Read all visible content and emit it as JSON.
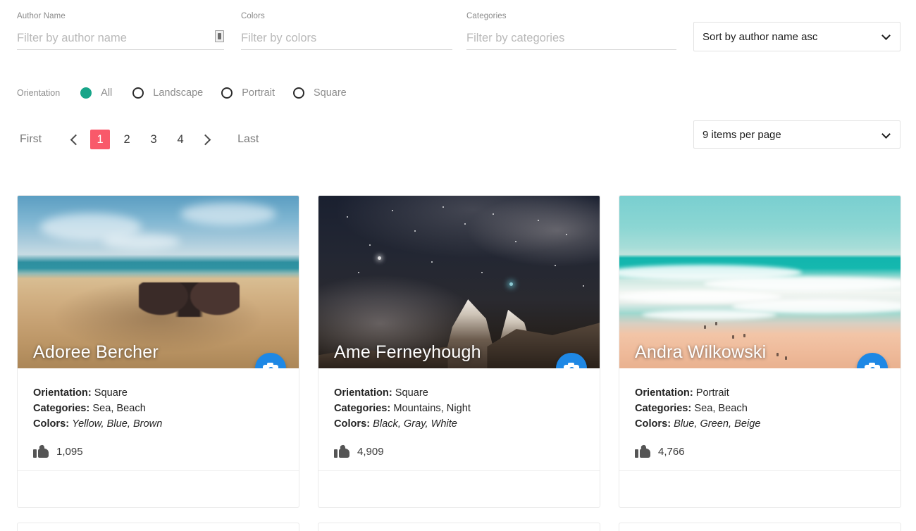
{
  "filters": {
    "author": {
      "label": "Author Name",
      "placeholder": "Filter by author name",
      "value": ""
    },
    "colors": {
      "label": "Colors",
      "placeholder": "Filter by colors",
      "value": ""
    },
    "categories": {
      "label": "Categories",
      "placeholder": "Filter by categories",
      "value": ""
    },
    "sort": {
      "selected": "Sort by author name asc"
    }
  },
  "orientation": {
    "label": "Orientation",
    "selected": "All",
    "options": [
      {
        "label": "All",
        "selected": true
      },
      {
        "label": "Landscape",
        "selected": false
      },
      {
        "label": "Portrait",
        "selected": false
      },
      {
        "label": "Square",
        "selected": false
      }
    ]
  },
  "pagination": {
    "first_label": "First",
    "last_label": "Last",
    "pages": [
      "1",
      "2",
      "3",
      "4"
    ],
    "active_page": "1",
    "per_page": {
      "selected": "9 items per page"
    }
  },
  "labels": {
    "orientation_prefix": "Orientation:",
    "categories_prefix": "Categories:",
    "colors_prefix": "Colors:"
  },
  "colors": {
    "accent_active_page": "#f9596a",
    "radio_selected": "#17a589",
    "fab": "#1e88e5",
    "thumb_icon": "#555555"
  },
  "cards": [
    {
      "author": "Adoree Bercher",
      "orientation": "Square",
      "categories": "Sea, Beach",
      "colors": "Yellow, Blue, Brown",
      "likes": "1,095",
      "photo": "beach-sunglasses-sand"
    },
    {
      "author": "Ame Ferneyhough",
      "orientation": "Square",
      "categories": "Mountains, Night",
      "colors": "Black, Gray, White",
      "likes": "4,909",
      "photo": "night-sky-mountain"
    },
    {
      "author": "Andra Wilkowski",
      "orientation": "Portrait",
      "categories": "Sea, Beach",
      "colors": "Blue, Green, Beige",
      "likes": "4,766",
      "photo": "aerial-beach-surf"
    }
  ]
}
